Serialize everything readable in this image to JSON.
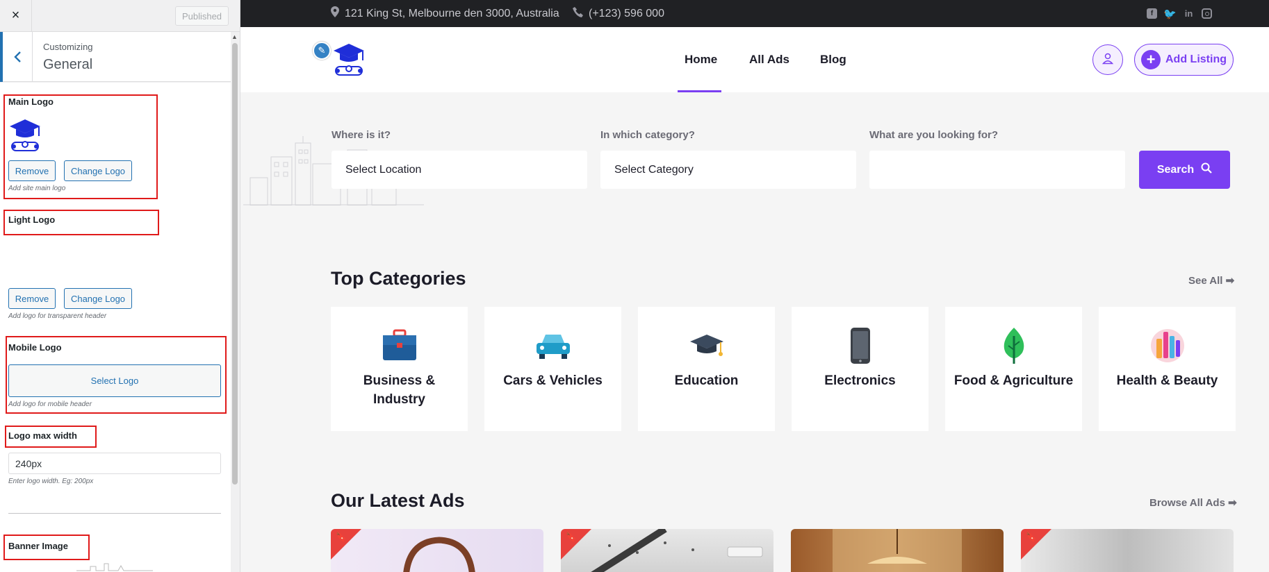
{
  "customizer": {
    "close_label": "×",
    "published_label": "Published",
    "breadcrumb": "Customizing",
    "section_title": "General",
    "main_logo": {
      "label": "Main Logo",
      "remove_label": "Remove",
      "change_label": "Change Logo",
      "description": "Add site main logo"
    },
    "light_logo": {
      "label": "Light Logo",
      "remove_label": "Remove",
      "change_label": "Change Logo",
      "description": "Add logo for transparent header"
    },
    "mobile_logo": {
      "label": "Mobile Logo",
      "select_label": "Select Logo",
      "description": "Add logo for mobile header"
    },
    "logo_max_width": {
      "label": "Logo max width",
      "value": "240px",
      "description": "Enter logo width. Eg: 200px"
    },
    "banner_image": {
      "label": "Banner Image"
    },
    "highlight_color": "#e01a1a",
    "accent_color": "#2271b1"
  },
  "site": {
    "topbar": {
      "address": "121 King St, Melbourne den 3000, Australia",
      "phone": "(+123) 596 000",
      "social_icons": [
        "facebook-icon",
        "twitter-icon",
        "linkedin-icon",
        "instagram-icon"
      ]
    },
    "nav": {
      "items": [
        "Home",
        "All Ads",
        "Blog"
      ],
      "active": "Home",
      "add_listing_label": "Add Listing"
    },
    "search": {
      "location_label": "Where is it?",
      "location_value": "Select Location",
      "category_label": "In which category?",
      "category_value": "Select Category",
      "keyword_label": "What are you looking for?",
      "keyword_value": "",
      "button_label": "Search"
    },
    "top_categories": {
      "title": "Top Categories",
      "see_all": "See All ➡",
      "items": [
        {
          "name": "Business & Industry",
          "icon": "briefcase-icon"
        },
        {
          "name": "Cars & Vehicles",
          "icon": "car-icon"
        },
        {
          "name": "Education",
          "icon": "graduation-cap-icon"
        },
        {
          "name": "Electronics",
          "icon": "smartphone-icon"
        },
        {
          "name": "Food & Agriculture",
          "icon": "leaf-icon"
        },
        {
          "name": "Health & Beauty",
          "icon": "cosmetics-icon"
        }
      ]
    },
    "latest_ads": {
      "title": "Our Latest Ads",
      "browse_all": "Browse All Ads ➡"
    },
    "accent_color": "#7a3ff2"
  }
}
